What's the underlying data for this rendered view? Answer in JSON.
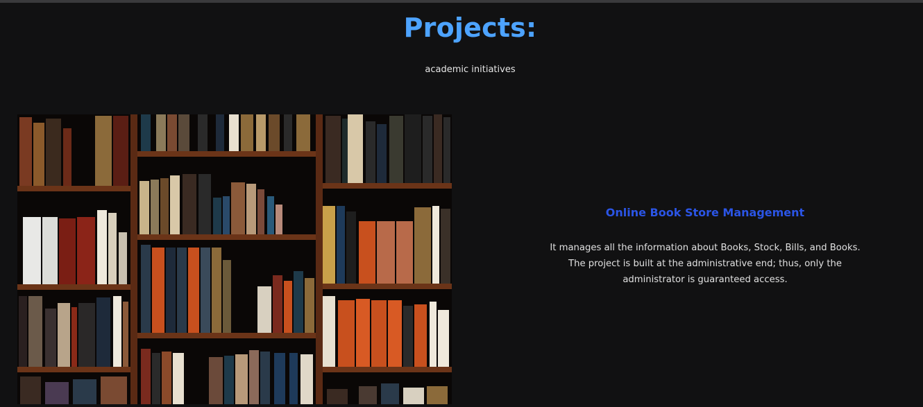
{
  "section": {
    "title": "Projects:",
    "subtitle": "academic initiatives"
  },
  "project": {
    "image_name": "bookshelf-image",
    "title": "Online Book Store Management",
    "description": "It manages all the information about Books, Stock, Bills, and Books. The project is built at the administrative end; thus, only the administrator is guaranteed access."
  },
  "colors": {
    "background": "#111112",
    "title": "#4da3ff",
    "card_title": "#2b55e6",
    "text": "#e0e0e0"
  }
}
